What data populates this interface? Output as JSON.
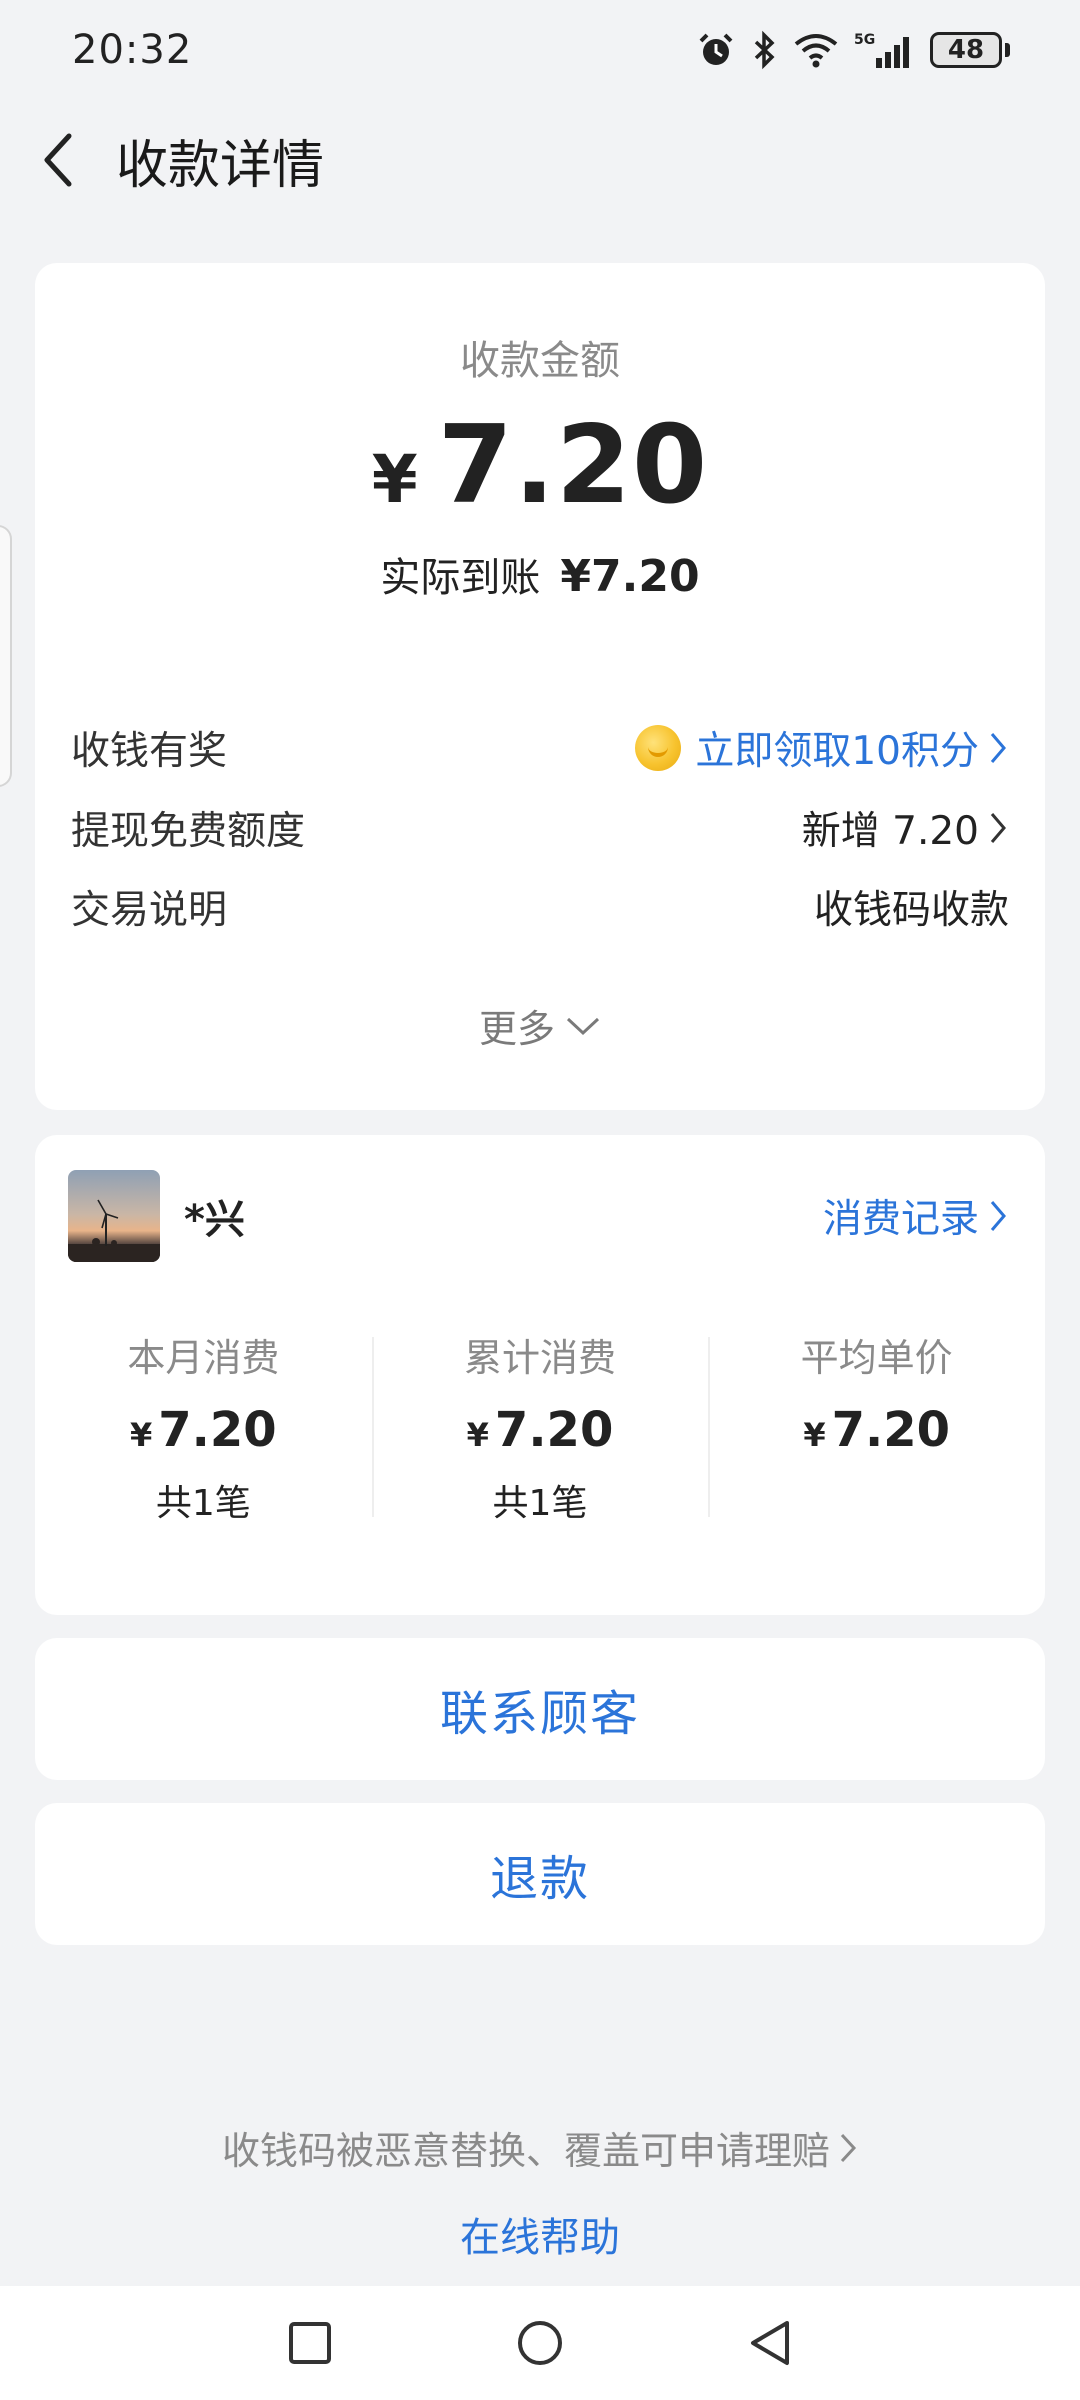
{
  "status_bar": {
    "time": "20:32",
    "network": "5G",
    "battery": "48"
  },
  "header": {
    "title": "收款详情"
  },
  "summary": {
    "amount_label": "收款金额",
    "currency": "¥",
    "amount": "7.20",
    "actual_label": "实际到账",
    "actual_amount": "¥7.20"
  },
  "details": [
    {
      "label": "收钱有奖",
      "value": "立即领取10积分"
    },
    {
      "label": "提现免费额度",
      "value": "新增 7.20"
    },
    {
      "label": "交易说明",
      "value": "收钱码收款"
    }
  ],
  "more_label": "更多",
  "customer": {
    "name": "*兴",
    "records_link": "消费记录",
    "stats": [
      {
        "label": "本月消费",
        "currency": "¥",
        "value": "7.20",
        "count": "共1笔"
      },
      {
        "label": "累计消费",
        "currency": "¥",
        "value": "7.20",
        "count": "共1笔"
      },
      {
        "label": "平均单价",
        "currency": "¥",
        "value": "7.20",
        "count": ""
      }
    ]
  },
  "actions": {
    "contact": "联系顾客",
    "refund": "退款"
  },
  "footer": {
    "claim_text": "收钱码被恶意替换、覆盖可申请理赔",
    "help": "在线帮助"
  },
  "colors": {
    "accent": "#2b74d9",
    "background": "#f2f3f5",
    "card": "#ffffff"
  }
}
